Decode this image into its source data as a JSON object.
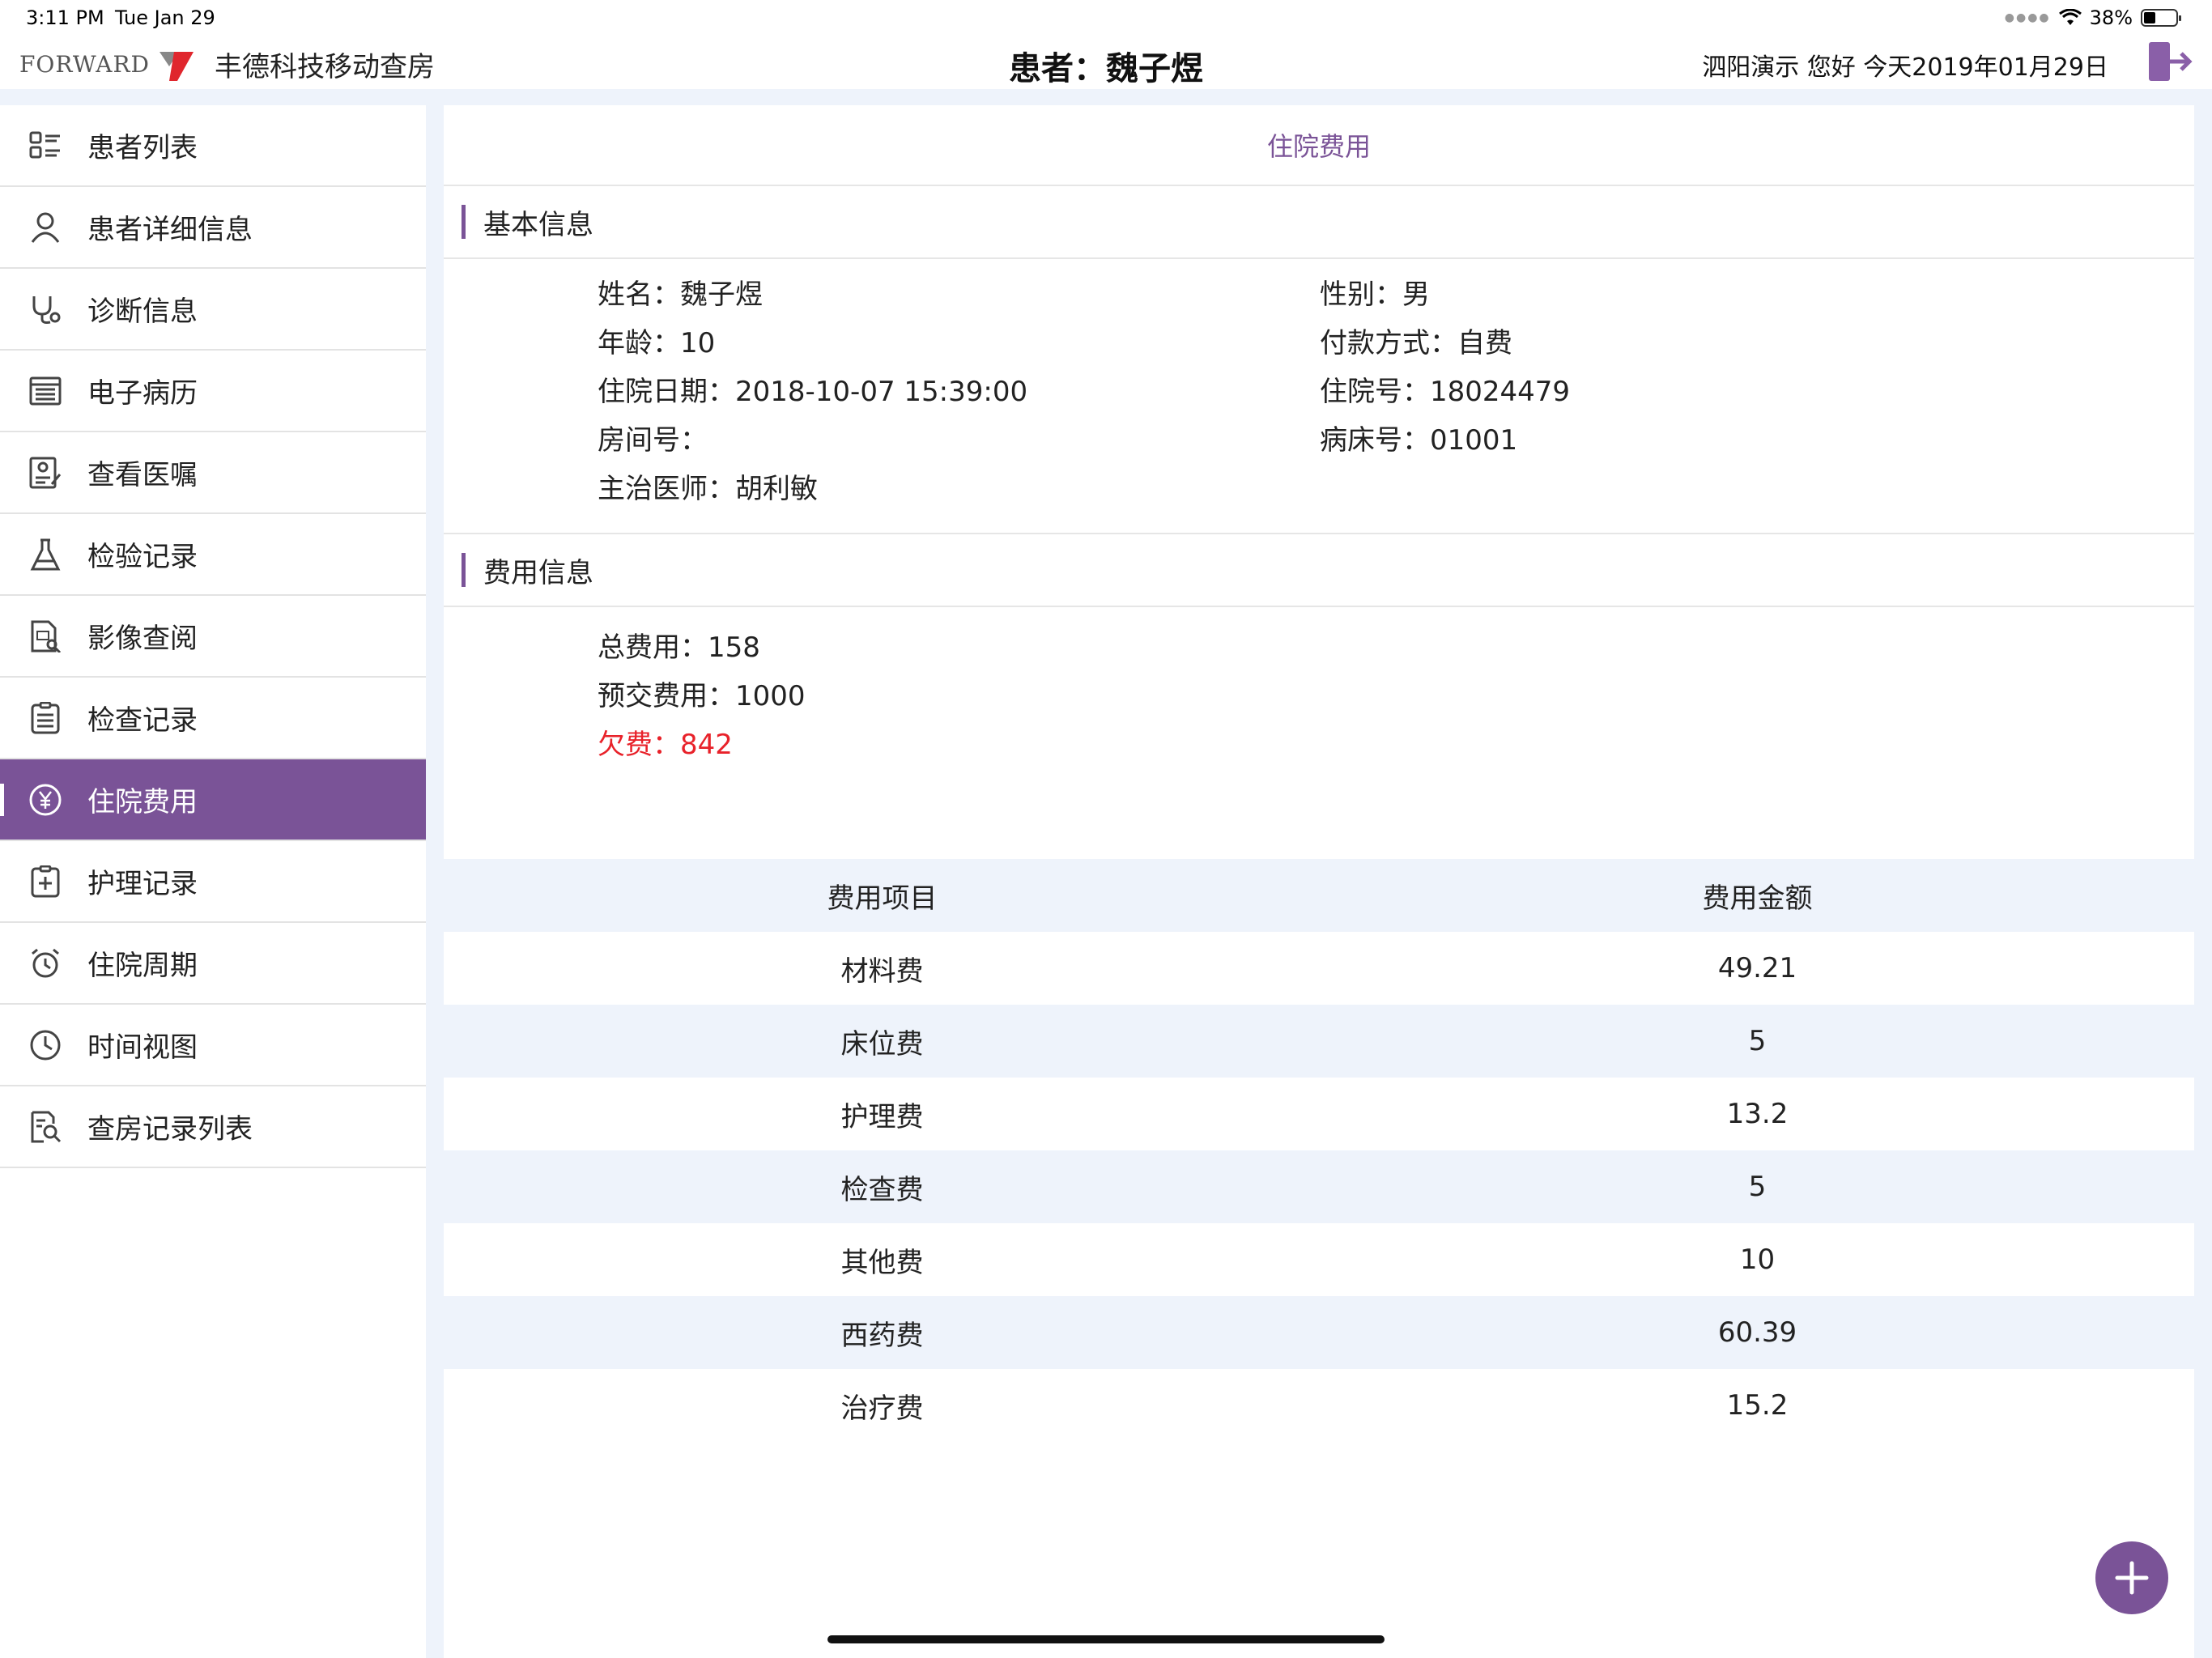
{
  "status": {
    "time": "3:11 PM",
    "date": "Tue Jan 29",
    "battery": "38%"
  },
  "header": {
    "logo_word": "FORWARD",
    "app_name": "丰德科技移动查房",
    "patient_title": "患者：魏子煜",
    "greeting": "泗阳演示 您好 今天2019年01月29日"
  },
  "sidebar": {
    "items": [
      {
        "label": "患者列表",
        "icon": "patient-list-icon"
      },
      {
        "label": "患者详细信息",
        "icon": "person-icon"
      },
      {
        "label": "诊断信息",
        "icon": "stethoscope-icon"
      },
      {
        "label": "电子病历",
        "icon": "medical-record-icon"
      },
      {
        "label": "查看医嘱",
        "icon": "doctor-order-icon"
      },
      {
        "label": "检验记录",
        "icon": "flask-icon"
      },
      {
        "label": "影像查阅",
        "icon": "image-doc-icon"
      },
      {
        "label": "检查记录",
        "icon": "clipboard-icon"
      },
      {
        "label": "住院费用",
        "icon": "yen-icon"
      },
      {
        "label": "护理记录",
        "icon": "nursing-icon"
      },
      {
        "label": "住院周期",
        "icon": "alarm-icon"
      },
      {
        "label": "时间视图",
        "icon": "clock-icon"
      },
      {
        "label": "查房记录列表",
        "icon": "search-doc-icon"
      }
    ],
    "active_index": 8
  },
  "content": {
    "page_title": "住院费用",
    "basic_section": "基本信息",
    "basic": {
      "name": "姓名：魏子煜",
      "gender": "性别：男",
      "age": "年龄：10",
      "payment": "付款方式：自费",
      "admit_date": "住院日期：2018-10-07 15:39:00",
      "admit_no": "住院号：18024479",
      "room": "房间号：",
      "bed": "病床号：01001",
      "doctor": "主治医师：胡利敏"
    },
    "fee_section": "费用信息",
    "fees": {
      "total": "总费用：158",
      "prepaid": "预交费用：1000",
      "arrears": "欠费：842"
    },
    "table": {
      "headers": [
        "费用项目",
        "费用金额"
      ],
      "rows": [
        [
          "材料费",
          "49.21"
        ],
        [
          "床位费",
          "5"
        ],
        [
          "护理费",
          "13.2"
        ],
        [
          "检查费",
          "5"
        ],
        [
          "其他费",
          "10"
        ],
        [
          "西药费",
          "60.39"
        ],
        [
          "治疗费",
          "15.2"
        ]
      ]
    }
  },
  "colors": {
    "accent": "#7a5397",
    "arrears": "#e8222a",
    "panel_bg": "#eef3fb"
  }
}
